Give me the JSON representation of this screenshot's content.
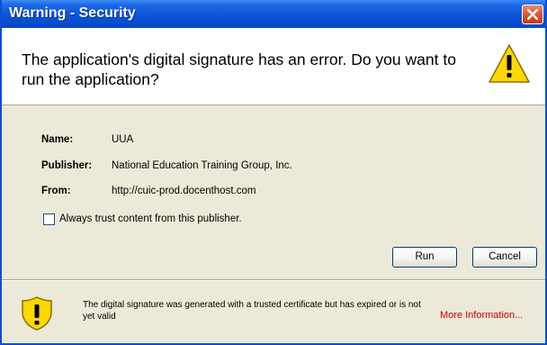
{
  "window": {
    "title": "Warning - Security",
    "close_icon": "close-x"
  },
  "header": {
    "message": "The application's digital signature has an error.  Do you want to run the application?",
    "icon": "warning-triangle-icon"
  },
  "details": {
    "name_label": "Name:",
    "name_value": "UUA",
    "publisher_label": "Publisher:",
    "publisher_value": "National Education Training Group, Inc.",
    "from_label": "From:",
    "from_value": "http://cuic-prod.docenthost.com"
  },
  "trust_checkbox": {
    "label": "Always trust content from this publisher.",
    "checked": false
  },
  "buttons": {
    "run": "Run",
    "cancel": "Cancel"
  },
  "footer": {
    "message": "The digital signature was generated with a trusted certificate but has expired or is not yet valid",
    "more_info": "More Information...",
    "icon": "shield-warning-icon"
  },
  "colors": {
    "titlebar": "#0a55d9",
    "dialog_bg": "#ece9d8",
    "link": "#cc0000",
    "warning_yellow": "#ffd800"
  }
}
